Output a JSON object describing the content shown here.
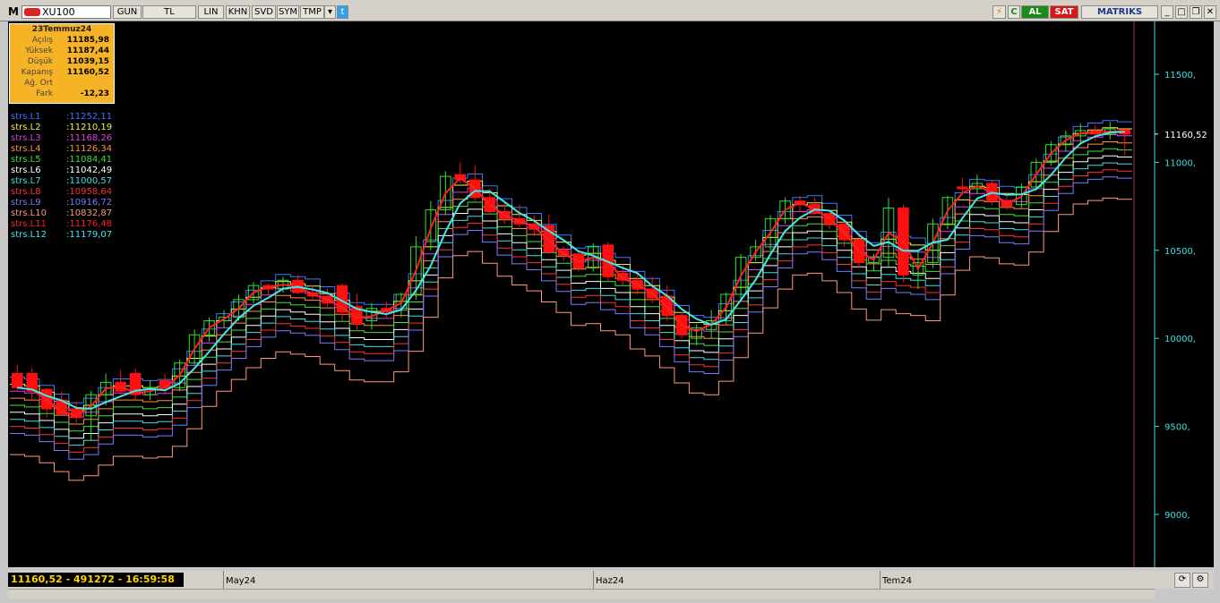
{
  "toolbar": {
    "logo": "M",
    "symbol": "XU100",
    "buttons": [
      "GUN",
      "TL",
      "LIN",
      "KHN",
      "SVD",
      "SYM",
      "TMP"
    ],
    "buy_label": "AL",
    "sell_label": "SAT",
    "brand": "MATRIKS",
    "colors": {
      "buy": "#1a8a1a",
      "sell": "#d81818",
      "twitter": "#2fa1e8"
    }
  },
  "info_box": {
    "date": "23Temmuz24",
    "rows": [
      {
        "label": "Açılış",
        "value": "11185,98"
      },
      {
        "label": "Yüksek",
        "value": "11187,44"
      },
      {
        "label": "Düşük",
        "value": "11039,15"
      },
      {
        "label": "Kapanış",
        "value": "11160,52"
      },
      {
        "label": "Ağ. Ort",
        "value": ""
      },
      {
        "label": "Fark",
        "value": "-12,23"
      }
    ]
  },
  "legend": [
    {
      "name": "strs.L1",
      "value": ":11252,11",
      "color": "#3c78ff"
    },
    {
      "name": "strs.L2",
      "value": ":11210,19",
      "color": "#f0f050"
    },
    {
      "name": "strs.L3",
      "value": ":11168,26",
      "color": "#e040e0"
    },
    {
      "name": "strs.L4",
      "value": ":11126,34",
      "color": "#ff9040"
    },
    {
      "name": "strs.L5",
      "value": ":11084,41",
      "color": "#40e040"
    },
    {
      "name": "strs.L6",
      "value": ":11042,49",
      "color": "#ffffff"
    },
    {
      "name": "strs.L7",
      "value": ":11000,57",
      "color": "#40e0e0"
    },
    {
      "name": "strs.L8",
      "value": ":10958,64",
      "color": "#ff3030"
    },
    {
      "name": "strs.L9",
      "value": ":10916,72",
      "color": "#7a7aff"
    },
    {
      "name": "strs.L10",
      "value": ":10832,87",
      "color": "#ff9a7a"
    },
    {
      "name": "strs.L11",
      "value": ":11176,48",
      "color": "#ff2020"
    },
    {
      "name": "strs.L12",
      "value": ":11179,07",
      "color": "#40e8f0"
    }
  ],
  "status": {
    "readout": "11160,52 - 491272 - 16:59:58",
    "dates": [
      "May24",
      "Haz24",
      "Tem24"
    ]
  },
  "chart_data": {
    "type": "candlestick",
    "y_ticks": [
      9000,
      9500,
      10000,
      10500,
      11000,
      11500
    ],
    "y_tick_labels": [
      "9000,",
      "9500,",
      "10000,",
      "10500,",
      "11000,",
      "11500,"
    ],
    "last_price": 11160.52,
    "last_price_label": "11160,52",
    "ylim": [
      8700,
      11800
    ],
    "candles": [
      [
        9800,
        9850,
        9700,
        9720
      ],
      [
        9800,
        9830,
        9650,
        9700
      ],
      [
        9710,
        9720,
        9550,
        9600
      ],
      [
        9650,
        9700,
        9560,
        9570
      ],
      [
        9600,
        9640,
        9520,
        9550
      ],
      [
        9560,
        9700,
        9420,
        9680
      ],
      [
        9680,
        9800,
        9620,
        9750
      ],
      [
        9750,
        9820,
        9680,
        9700
      ],
      [
        9800,
        9830,
        9650,
        9680
      ],
      [
        9680,
        9760,
        9650,
        9720
      ],
      [
        9760,
        9800,
        9690,
        9720
      ],
      [
        9720,
        9880,
        9700,
        9860
      ],
      [
        9860,
        10050,
        9850,
        10020
      ],
      [
        10020,
        10120,
        9980,
        10100
      ],
      [
        10100,
        10160,
        10060,
        10120
      ],
      [
        10120,
        10250,
        10100,
        10220
      ],
      [
        10220,
        10320,
        10200,
        10300
      ],
      [
        10300,
        10310,
        10250,
        10280
      ],
      [
        10280,
        10350,
        10260,
        10330
      ],
      [
        10330,
        10360,
        10250,
        10260
      ],
      [
        10260,
        10300,
        10220,
        10240
      ],
      [
        10240,
        10280,
        10180,
        10200
      ],
      [
        10300,
        10310,
        10100,
        10150
      ],
      [
        10180,
        10250,
        10040,
        10080
      ],
      [
        10100,
        10200,
        10050,
        10170
      ],
      [
        10170,
        10210,
        10120,
        10150
      ],
      [
        10160,
        10260,
        10120,
        10250
      ],
      [
        10250,
        10580,
        10220,
        10520
      ],
      [
        10550,
        10780,
        10500,
        10730
      ],
      [
        10730,
        10950,
        10700,
        10920
      ],
      [
        10930,
        11000,
        10880,
        10900
      ],
      [
        10900,
        10980,
        10780,
        10800
      ],
      [
        10800,
        10850,
        10700,
        10720
      ],
      [
        10720,
        10780,
        10650,
        10680
      ],
      [
        10680,
        10760,
        10630,
        10650
      ],
      [
        10650,
        10700,
        10580,
        10620
      ],
      [
        10640,
        10700,
        10480,
        10490
      ],
      [
        10500,
        10520,
        10440,
        10470
      ],
      [
        10480,
        10490,
        10380,
        10400
      ],
      [
        10400,
        10540,
        10380,
        10520
      ],
      [
        10530,
        10550,
        10320,
        10350
      ],
      [
        10370,
        10420,
        10300,
        10330
      ],
      [
        10330,
        10380,
        10250,
        10280
      ],
      [
        10280,
        10350,
        10200,
        10230
      ],
      [
        10240,
        10300,
        10100,
        10130
      ],
      [
        10130,
        10150,
        10000,
        10020
      ],
      [
        10000,
        10080,
        9960,
        10060
      ],
      [
        10050,
        10160,
        10000,
        10100
      ],
      [
        10100,
        10260,
        10080,
        10250
      ],
      [
        10250,
        10480,
        10220,
        10460
      ],
      [
        10460,
        10560,
        10440,
        10520
      ],
      [
        10520,
        10700,
        10500,
        10680
      ],
      [
        10680,
        10800,
        10650,
        10780
      ],
      [
        10780,
        10810,
        10720,
        10760
      ],
      [
        10760,
        10800,
        10700,
        10710
      ],
      [
        10710,
        10730,
        10620,
        10650
      ],
      [
        10650,
        10680,
        10520,
        10560
      ],
      [
        10560,
        10600,
        10400,
        10430
      ],
      [
        10430,
        10480,
        10380,
        10460
      ],
      [
        10460,
        10800,
        10400,
        10740
      ],
      [
        10740,
        10760,
        10320,
        10360
      ],
      [
        10360,
        10500,
        10280,
        10430
      ],
      [
        10430,
        10680,
        10400,
        10650
      ],
      [
        10650,
        10810,
        10620,
        10800
      ],
      [
        10860,
        10910,
        10820,
        10850
      ],
      [
        10850,
        10930,
        10820,
        10880
      ],
      [
        10880,
        10900,
        10760,
        10780
      ],
      [
        10780,
        10830,
        10730,
        10750
      ],
      [
        10760,
        10880,
        10740,
        10860
      ],
      [
        10860,
        11020,
        10840,
        11000
      ],
      [
        11000,
        11120,
        10980,
        11100
      ],
      [
        11100,
        11180,
        11060,
        11150
      ],
      [
        11150,
        11220,
        11100,
        11180
      ],
      [
        11180,
        11210,
        11120,
        11160
      ],
      [
        11160,
        11230,
        11130,
        11190
      ],
      [
        11186,
        11187,
        11039,
        11161
      ]
    ],
    "bands": {
      "names": [
        "strs.L1",
        "strs.L2",
        "strs.L3",
        "strs.L4",
        "strs.L5",
        "strs.L6",
        "strs.L7",
        "strs.L8",
        "strs.L9",
        "strs.L10"
      ],
      "offsets": [
        60,
        20,
        -20,
        -60,
        -100,
        -140,
        -180,
        -220,
        -260,
        -380
      ]
    }
  }
}
